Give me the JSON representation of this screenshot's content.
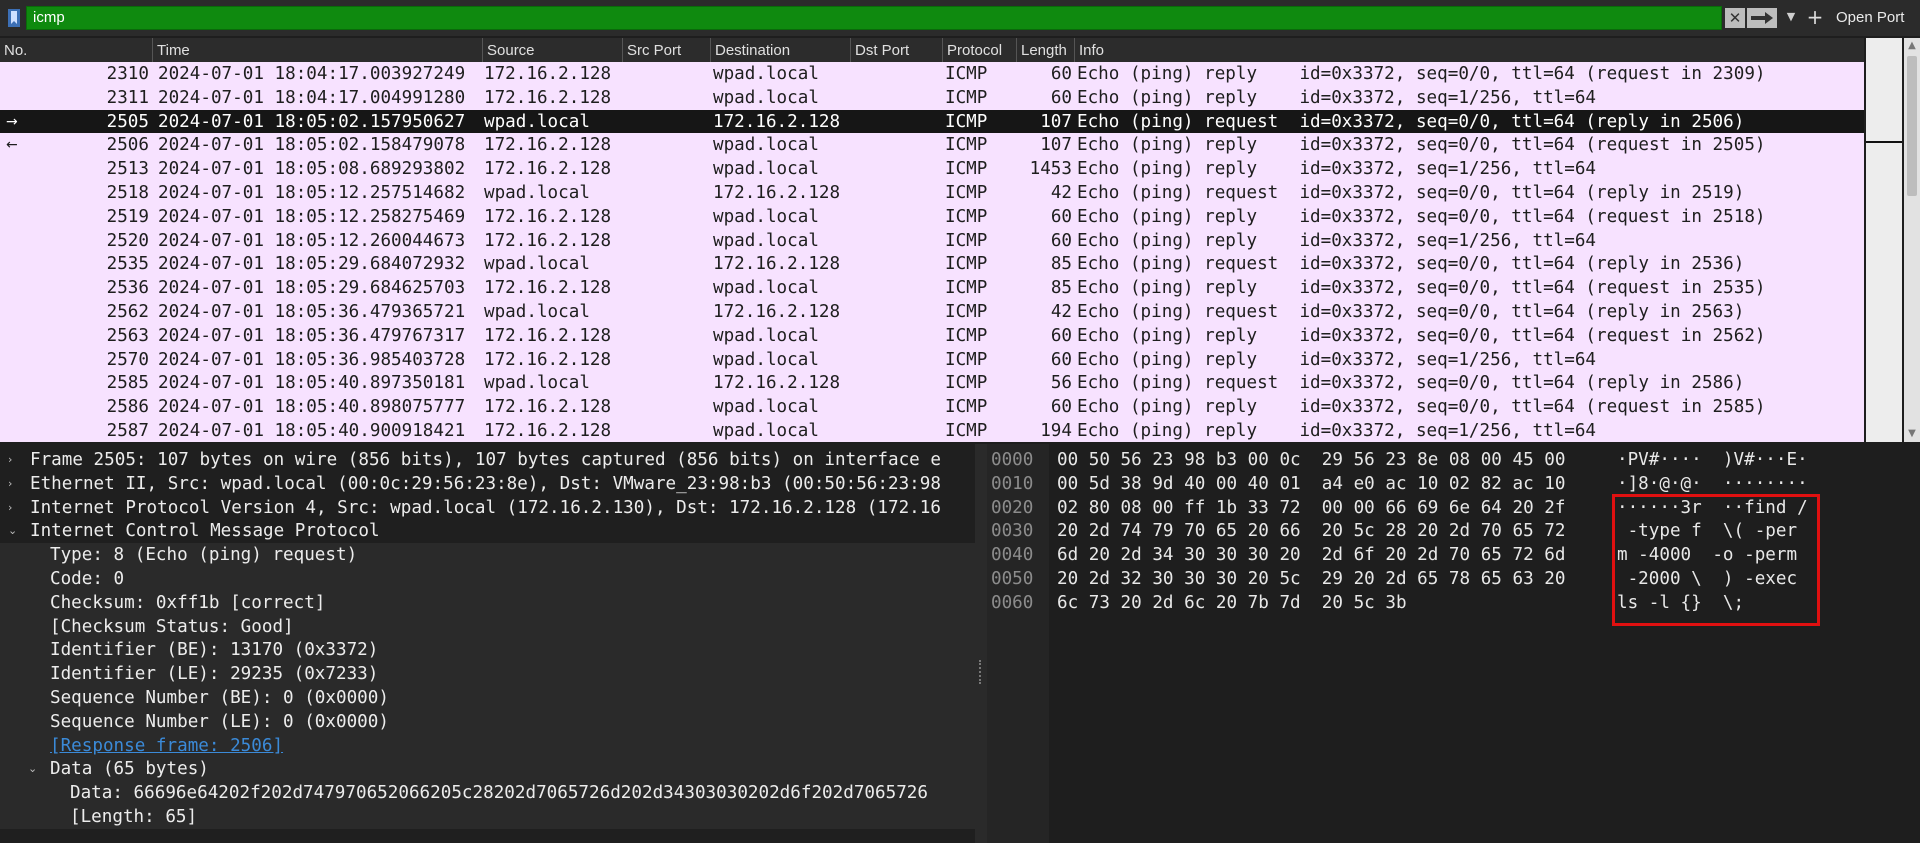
{
  "filter": {
    "value": "icmp",
    "clear_label": "✕",
    "recent_label": "▼",
    "add_label": "+",
    "open_port_label": "Open Port"
  },
  "packet_list": {
    "columns": [
      "No.",
      "Time",
      "Source",
      "Src Port",
      "Destination",
      "Dst Port",
      "Protocol",
      "Length",
      "Info"
    ],
    "rows": [
      {
        "no": "2310",
        "time": "2024-07-01 18:04:17.003927249",
        "src": "172.16.2.128",
        "dst": "wpad.local",
        "proto": "ICMP",
        "len": "60",
        "info": "Echo (ping) reply    id=0x3372, seq=0/0, ttl=64 (request in 2309)"
      },
      {
        "no": "2311",
        "time": "2024-07-01 18:04:17.004991280",
        "src": "172.16.2.128",
        "dst": "wpad.local",
        "proto": "ICMP",
        "len": "60",
        "info": "Echo (ping) reply    id=0x3372, seq=1/256, ttl=64"
      },
      {
        "no": "2505",
        "time": "2024-07-01 18:05:02.157950627",
        "src": "wpad.local",
        "dst": "172.16.2.128",
        "proto": "ICMP",
        "len": "107",
        "info": "Echo (ping) request  id=0x3372, seq=0/0, ttl=64 (reply in 2506)",
        "selected": true,
        "rel": "→"
      },
      {
        "no": "2506",
        "time": "2024-07-01 18:05:02.158479078",
        "src": "172.16.2.128",
        "dst": "wpad.local",
        "proto": "ICMP",
        "len": "107",
        "info": "Echo (ping) reply    id=0x3372, seq=0/0, ttl=64 (request in 2505)",
        "rel": "←"
      },
      {
        "no": "2513",
        "time": "2024-07-01 18:05:08.689293802",
        "src": "172.16.2.128",
        "dst": "wpad.local",
        "proto": "ICMP",
        "len": "1453",
        "info": "Echo (ping) reply    id=0x3372, seq=1/256, ttl=64"
      },
      {
        "no": "2518",
        "time": "2024-07-01 18:05:12.257514682",
        "src": "wpad.local",
        "dst": "172.16.2.128",
        "proto": "ICMP",
        "len": "42",
        "info": "Echo (ping) request  id=0x3372, seq=0/0, ttl=64 (reply in 2519)"
      },
      {
        "no": "2519",
        "time": "2024-07-01 18:05:12.258275469",
        "src": "172.16.2.128",
        "dst": "wpad.local",
        "proto": "ICMP",
        "len": "60",
        "info": "Echo (ping) reply    id=0x3372, seq=0/0, ttl=64 (request in 2518)"
      },
      {
        "no": "2520",
        "time": "2024-07-01 18:05:12.260044673",
        "src": "172.16.2.128",
        "dst": "wpad.local",
        "proto": "ICMP",
        "len": "60",
        "info": "Echo (ping) reply    id=0x3372, seq=1/256, ttl=64"
      },
      {
        "no": "2535",
        "time": "2024-07-01 18:05:29.684072932",
        "src": "wpad.local",
        "dst": "172.16.2.128",
        "proto": "ICMP",
        "len": "85",
        "info": "Echo (ping) request  id=0x3372, seq=0/0, ttl=64 (reply in 2536)"
      },
      {
        "no": "2536",
        "time": "2024-07-01 18:05:29.684625703",
        "src": "172.16.2.128",
        "dst": "wpad.local",
        "proto": "ICMP",
        "len": "85",
        "info": "Echo (ping) reply    id=0x3372, seq=0/0, ttl=64 (request in 2535)"
      },
      {
        "no": "2562",
        "time": "2024-07-01 18:05:36.479365721",
        "src": "wpad.local",
        "dst": "172.16.2.128",
        "proto": "ICMP",
        "len": "42",
        "info": "Echo (ping) request  id=0x3372, seq=0/0, ttl=64 (reply in 2563)"
      },
      {
        "no": "2563",
        "time": "2024-07-01 18:05:36.479767317",
        "src": "172.16.2.128",
        "dst": "wpad.local",
        "proto": "ICMP",
        "len": "60",
        "info": "Echo (ping) reply    id=0x3372, seq=0/0, ttl=64 (request in 2562)"
      },
      {
        "no": "2570",
        "time": "2024-07-01 18:05:36.985403728",
        "src": "172.16.2.128",
        "dst": "wpad.local",
        "proto": "ICMP",
        "len": "60",
        "info": "Echo (ping) reply    id=0x3372, seq=1/256, ttl=64"
      },
      {
        "no": "2585",
        "time": "2024-07-01 18:05:40.897350181",
        "src": "wpad.local",
        "dst": "172.16.2.128",
        "proto": "ICMP",
        "len": "56",
        "info": "Echo (ping) request  id=0x3372, seq=0/0, ttl=64 (reply in 2586)"
      },
      {
        "no": "2586",
        "time": "2024-07-01 18:05:40.898075777",
        "src": "172.16.2.128",
        "dst": "wpad.local",
        "proto": "ICMP",
        "len": "60",
        "info": "Echo (ping) reply    id=0x3372, seq=0/0, ttl=64 (request in 2585)"
      },
      {
        "no": "2587",
        "time": "2024-07-01 18:05:40.900918421",
        "src": "172.16.2.128",
        "dst": "wpad.local",
        "proto": "ICMP",
        "len": "194",
        "info": "Echo (ping) reply    id=0x3372, seq=1/256, ttl=64"
      }
    ]
  },
  "details": {
    "rows": [
      {
        "toggle": "›",
        "text": "Frame 2505: 107 bytes on wire (856 bits), 107 bytes captured (856 bits) on interface e",
        "indent": 0
      },
      {
        "toggle": "›",
        "text": "Ethernet II, Src: wpad.local (00:0c:29:56:23:8e), Dst: VMware_23:98:b3 (00:50:56:23:98",
        "indent": 0
      },
      {
        "toggle": "›",
        "text": "Internet Protocol Version 4, Src: wpad.local (172.16.2.130), Dst: 172.16.2.128 (172.16",
        "indent": 0
      },
      {
        "toggle": "⌄",
        "text": "Internet Control Message Protocol",
        "indent": 0
      },
      {
        "toggle": "",
        "text": "Type: 8 (Echo (ping) request)",
        "indent": 1
      },
      {
        "toggle": "",
        "text": "Code: 0",
        "indent": 1
      },
      {
        "toggle": "",
        "text": "Checksum: 0xff1b [correct]",
        "indent": 1
      },
      {
        "toggle": "",
        "text": "[Checksum Status: Good]",
        "indent": 1
      },
      {
        "toggle": "",
        "text": "Identifier (BE): 13170 (0x3372)",
        "indent": 1
      },
      {
        "toggle": "",
        "text": "Identifier (LE): 29235 (0x7233)",
        "indent": 1
      },
      {
        "toggle": "",
        "text": "Sequence Number (BE): 0 (0x0000)",
        "indent": 1
      },
      {
        "toggle": "",
        "text": "Sequence Number (LE): 0 (0x0000)",
        "indent": 1
      },
      {
        "toggle": "",
        "text": "[Response frame: 2506]",
        "indent": 1,
        "link": true
      },
      {
        "toggle": "⌄",
        "text": "Data (65 bytes)",
        "indent": 1
      },
      {
        "toggle": "",
        "text": "Data: 66696e64202f202d747970652066205c28202d7065726d202d34303030202d6f202d7065726",
        "indent": 2
      },
      {
        "toggle": "",
        "text": "[Length: 65]",
        "indent": 2
      }
    ]
  },
  "bytes": {
    "rows": [
      {
        "offset": "0000",
        "hex": "00 50 56 23 98 b3 00 0c  29 56 23 8e 08 00 45 00",
        "ascii": "·PV#····  )V#···E·"
      },
      {
        "offset": "0010",
        "hex": "00 5d 38 9d 40 00 40 01  a4 e0 ac 10 02 82 ac 10",
        "ascii": "·]8·@·@·  ········"
      },
      {
        "offset": "0020",
        "hex": "02 80 08 00 ff 1b 33 72  00 00 66 69 6e 64 20 2f",
        "ascii": "······3r  ··find /"
      },
      {
        "offset": "0030",
        "hex": "20 2d 74 79 70 65 20 66  20 5c 28 20 2d 70 65 72",
        "ascii": " -type f  \\( -per"
      },
      {
        "offset": "0040",
        "hex": "6d 20 2d 34 30 30 30 20  2d 6f 20 2d 70 65 72 6d",
        "ascii": "m -4000  -o -perm"
      },
      {
        "offset": "0050",
        "hex": "20 2d 32 30 30 30 20 5c  29 20 2d 65 78 65 63 20",
        "ascii": " -2000 \\  ) -exec "
      },
      {
        "offset": "0060",
        "hex": "6c 73 20 2d 6c 20 7b 7d  20 5c 3b",
        "ascii": "ls -l {}  \\;"
      }
    ]
  },
  "colors": {
    "filter_bg": "#0f8a0f",
    "row_bg": "#f7e2ff",
    "selected_bg": "#161616",
    "highlight_border": "#e01010",
    "link": "#3b8ad8"
  }
}
